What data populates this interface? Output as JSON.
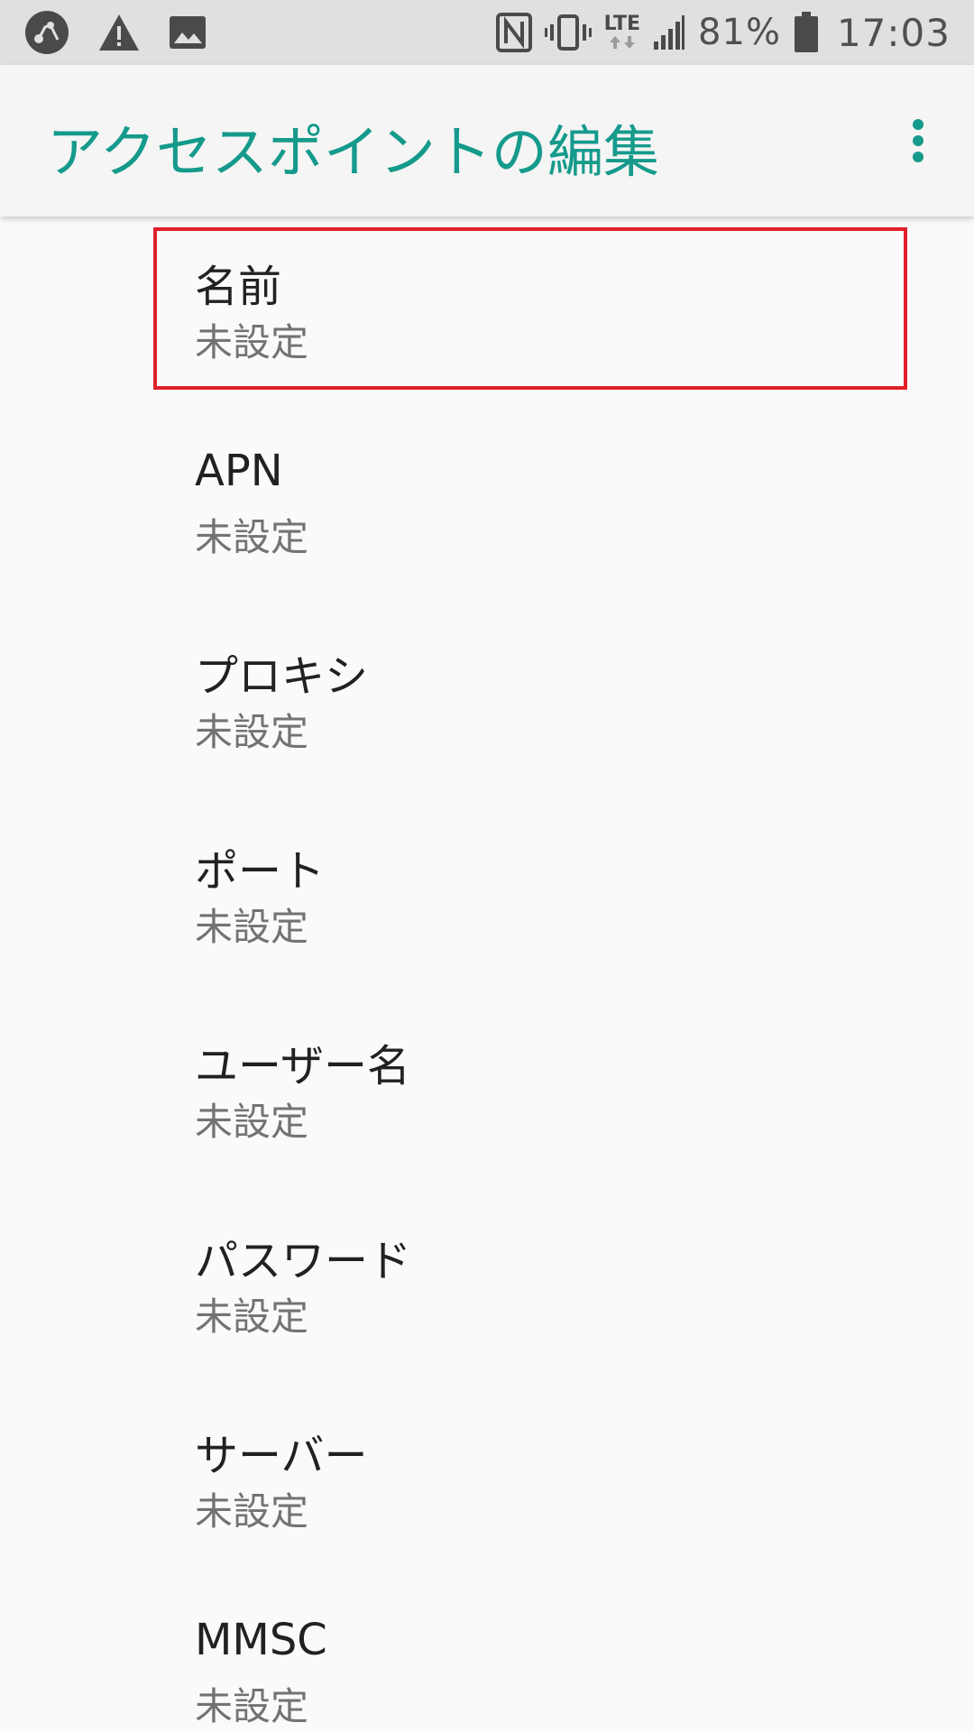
{
  "status_bar": {
    "battery_percent": "81%",
    "time": "17:03",
    "network_type": "LTE",
    "icons": [
      "ticket-app-icon",
      "warning-icon",
      "image-icon",
      "nfc-icon",
      "vibrate-icon",
      "lte-data-icon",
      "signal-icon",
      "battery-icon"
    ]
  },
  "app_bar": {
    "title": "アクセスポイントの編集",
    "menu_icon": "more-vert-icon"
  },
  "colors": {
    "accent": "#159a8b",
    "highlight_border": "#e0202a",
    "status_bar_bg": "#e0e0e0"
  },
  "items": [
    {
      "title": "名前",
      "summary": "未設定"
    },
    {
      "title": "APN",
      "summary": "未設定"
    },
    {
      "title": "プロキシ",
      "summary": "未設定"
    },
    {
      "title": "ポート",
      "summary": "未設定"
    },
    {
      "title": "ユーザー名",
      "summary": "未設定"
    },
    {
      "title": "パスワード",
      "summary": "未設定"
    },
    {
      "title": "サーバー",
      "summary": "未設定"
    },
    {
      "title": "MMSC",
      "summary": "未設定"
    }
  ]
}
